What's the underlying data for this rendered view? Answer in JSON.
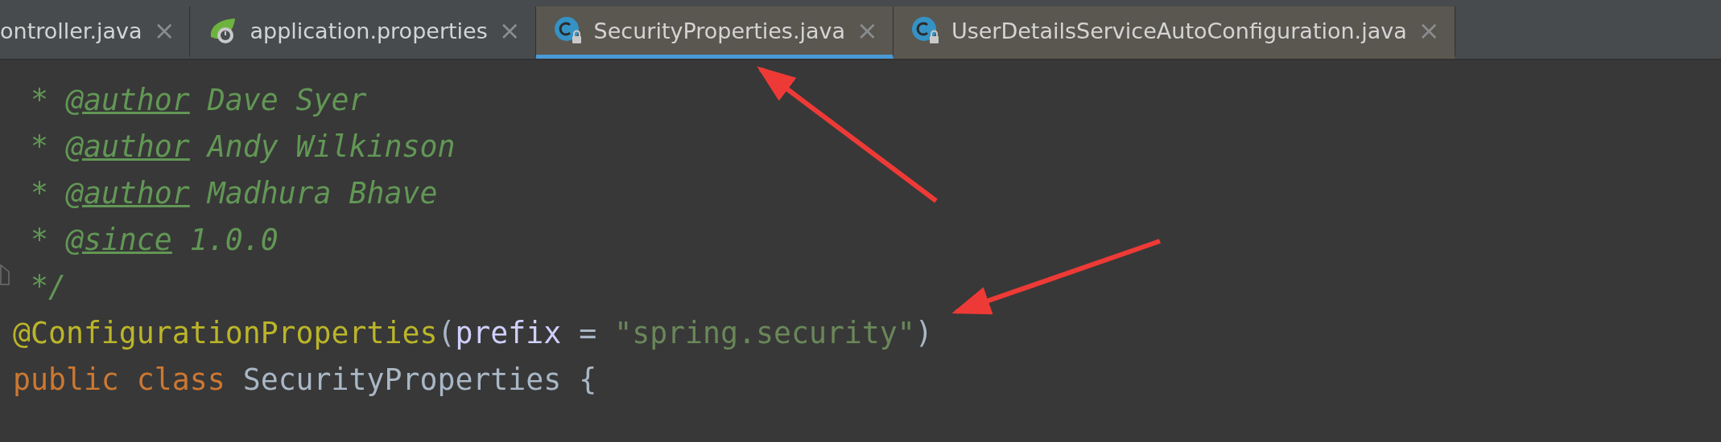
{
  "tabs": [
    {
      "label": "ontroller.java",
      "kind": "plain",
      "selected": false
    },
    {
      "label": "application.properties",
      "kind": "config",
      "selected": false
    },
    {
      "label": "SecurityProperties.java",
      "kind": "class",
      "selected": true,
      "color": "#5a5750"
    },
    {
      "label": "UserDetailsServiceAutoConfiguration.java",
      "kind": "class",
      "selected": false,
      "color": "#5a5750"
    }
  ],
  "close_symbol": "×",
  "code_lines": [
    {
      "fold": false,
      "segments": [
        {
          "kind": "comment",
          "text": " * "
        },
        {
          "kind": "doc_tag",
          "text": "@author"
        },
        {
          "kind": "comment",
          "text": " Dave Syer"
        }
      ]
    },
    {
      "fold": false,
      "segments": [
        {
          "kind": "comment",
          "text": " * "
        },
        {
          "kind": "doc_tag",
          "text": "@author"
        },
        {
          "kind": "comment",
          "text": " Andy Wilkinson"
        }
      ]
    },
    {
      "fold": false,
      "segments": [
        {
          "kind": "comment",
          "text": " * "
        },
        {
          "kind": "doc_tag",
          "text": "@author"
        },
        {
          "kind": "comment",
          "text": " Madhura Bhave"
        }
      ]
    },
    {
      "fold": false,
      "segments": [
        {
          "kind": "comment",
          "text": " * "
        },
        {
          "kind": "doc_tag",
          "text": "@since"
        },
        {
          "kind": "comment",
          "text": " 1.0.0"
        }
      ]
    },
    {
      "fold": true,
      "segments": [
        {
          "kind": "comment",
          "text": " */"
        }
      ]
    },
    {
      "fold": false,
      "segments": [
        {
          "kind": "annotation",
          "text": "@ConfigurationProperties"
        },
        {
          "kind": "plain",
          "text": "("
        },
        {
          "kind": "param",
          "text": "prefix"
        },
        {
          "kind": "plain",
          "text": " = "
        },
        {
          "kind": "string",
          "text": "\"spring.security\""
        },
        {
          "kind": "plain",
          "text": ")"
        }
      ]
    },
    {
      "fold": false,
      "segments": [
        {
          "kind": "keyword",
          "text": "public class "
        },
        {
          "kind": "plain",
          "text": "SecurityProperties {"
        }
      ]
    }
  ]
}
